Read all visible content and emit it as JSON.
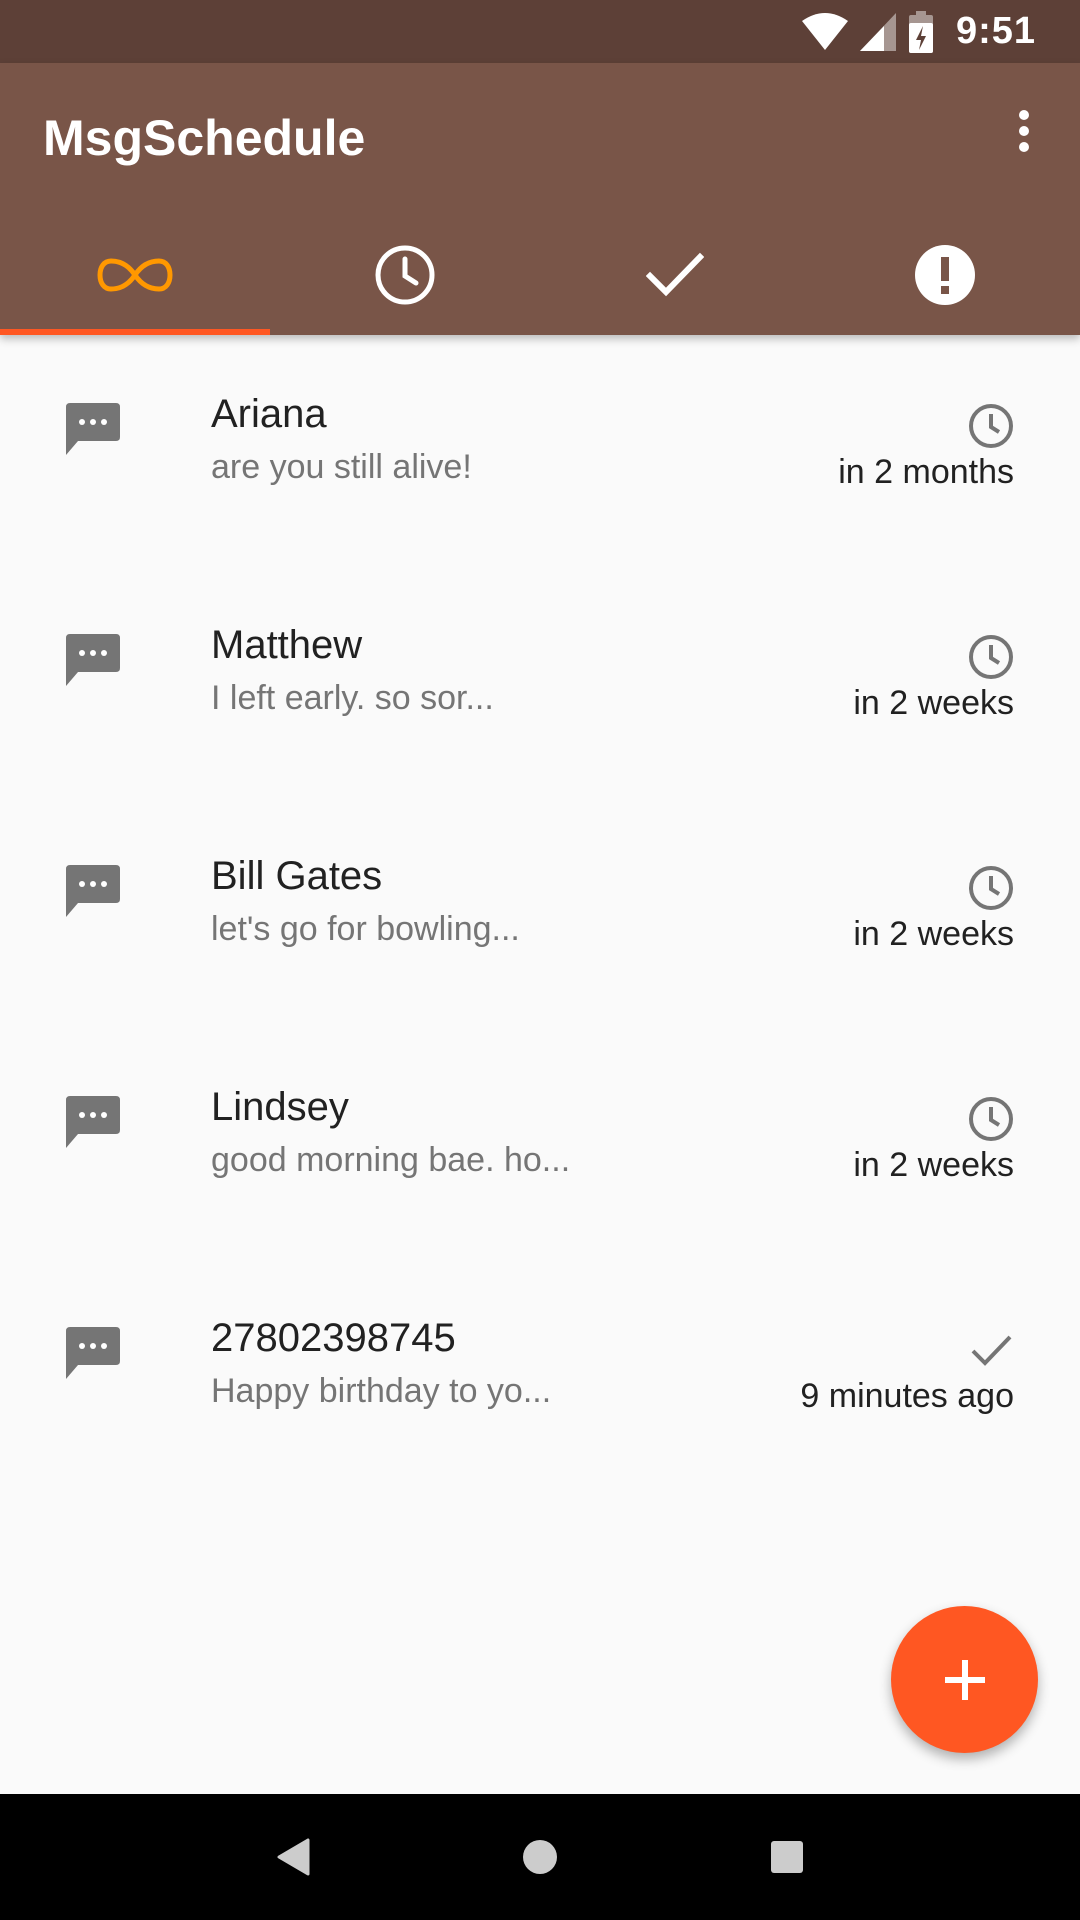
{
  "status_bar": {
    "time": "9:51",
    "icons": [
      "wifi-icon",
      "signal-icon",
      "battery-charging-icon"
    ]
  },
  "app_bar": {
    "title": "MsgSchedule",
    "overflow_icon": "more-vert-icon"
  },
  "tabs": [
    {
      "icon": "infinity-icon",
      "active": true
    },
    {
      "icon": "clock-icon",
      "active": false
    },
    {
      "icon": "check-icon",
      "active": false
    },
    {
      "icon": "alert-circle-icon",
      "active": false
    }
  ],
  "colors": {
    "status_bar": "#5d4037",
    "app_bar": "#795548",
    "accent": "#ff5722",
    "active_tab_icon": "#ff9800",
    "background": "#fafafa"
  },
  "messages": [
    {
      "name": "Ariana",
      "preview": "are you still alive!",
      "status_icon": "clock-icon",
      "when": "in 2 months"
    },
    {
      "name": "Matthew",
      "preview": "I left early. so sor...",
      "status_icon": "clock-icon",
      "when": "in 2 weeks"
    },
    {
      "name": "Bill Gates",
      "preview": "let's go for bowling...",
      "status_icon": "clock-icon",
      "when": "in 2 weeks"
    },
    {
      "name": "Lindsey",
      "preview": "good morning bae. ho...",
      "status_icon": "clock-icon",
      "when": "in 2 weeks"
    },
    {
      "name": "27802398745",
      "preview": "Happy birthday to yo...",
      "status_icon": "check-icon",
      "when": "9 minutes ago"
    }
  ],
  "fab": {
    "icon": "plus-icon"
  },
  "nav_bar": {
    "icons": [
      "back-icon",
      "home-icon",
      "recents-icon"
    ]
  }
}
